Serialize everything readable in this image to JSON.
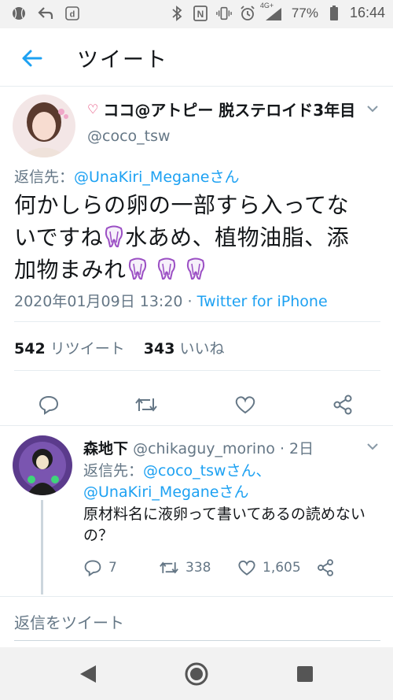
{
  "status_bar": {
    "battery": "77%",
    "time": "16:44",
    "network_label": "4G+"
  },
  "app_bar": {
    "title": "ツイート"
  },
  "main_tweet": {
    "author_name": "ココ@アトピー 脱ステロイド3年目",
    "author_handle": "@coco_tsw",
    "reply_prefix": "返信先：",
    "reply_mention": "@UnaKiri_Meganeさん",
    "text_line1": "何かしらの卵の一部すら入ってな",
    "text_line2a": "いですね",
    "text_line2b": "水あめ、植物油脂、添",
    "text_line3": "加物まみれ",
    "timestamp": "2020年01月09日 13:20",
    "separator": " · ",
    "source": "Twitter for iPhone",
    "retweet_count": "542",
    "retweet_label": "リツイート",
    "like_count": "343",
    "like_label": "いいね"
  },
  "reply_tweet": {
    "author_name": "森地下",
    "author_handle": "@chikaguy_morino",
    "time": "· 2日",
    "reply_prefix": "返信先：",
    "reply_mention1": "@coco_tswさん、",
    "reply_mention2": "@UnaKiri_Meganeさん",
    "text": "原材料名に液卵って書いてあるの読めないの？",
    "reply_count": "7",
    "retweet_count": "338",
    "like_count": "1,605"
  },
  "composer": {
    "placeholder": "返信をツイート"
  },
  "colors": {
    "accent": "#1da1f2",
    "secondary_text": "#657786",
    "primary_text": "#14171a",
    "divider": "#e6ecf0"
  },
  "icons": {
    "back": "arrow-left-icon",
    "reply": "reply-icon",
    "retweet": "retweet-icon",
    "like": "heart-icon",
    "share": "share-icon",
    "caret": "chevron-down-icon"
  }
}
